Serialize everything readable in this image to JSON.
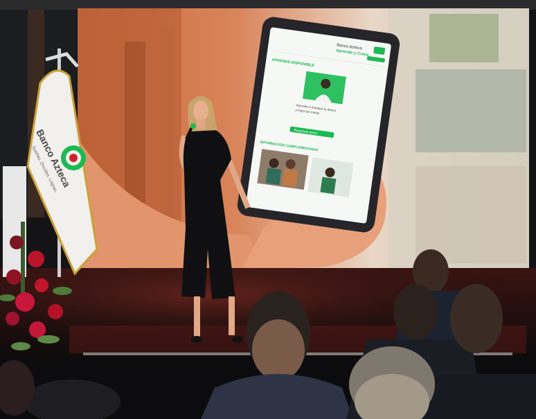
{
  "flag": {
    "brand_line1": "Banco Azteca",
    "brand_line2": "Sueñas. Decides. Logras."
  },
  "tablet": {
    "header_line1": "Banco Azteca",
    "header_line2": "Aprende y Crece",
    "section1_title": "APRENDE DISPONIBLE",
    "card_caption_line1": "Aprende a manejar tu dinero",
    "card_caption_line2": "y logra tus metas",
    "button_label": "Regístrate gratis",
    "section2_title": "INFORMACIÓN COMPLEMENTARIA"
  },
  "colors": {
    "brand_green": "#1db954",
    "brand_red": "#d0202b",
    "flag_gold": "#c9a23a"
  }
}
